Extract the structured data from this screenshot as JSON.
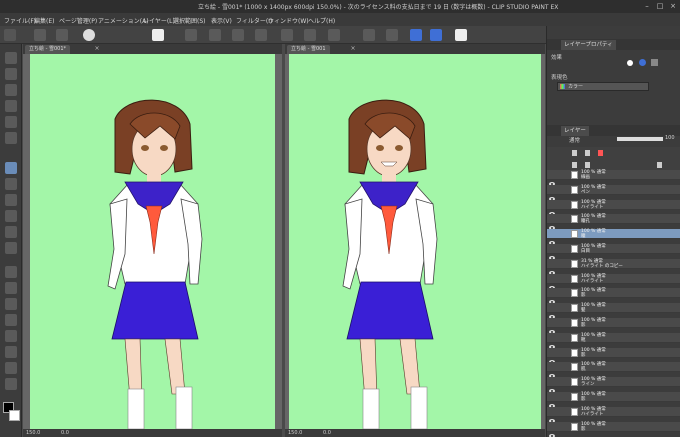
{
  "window": {
    "title": "立ち絵 - 雪001* (1000 x 1400px 600dpi 150.0%) - 次のライセンス料の支払日まで 19 日 (数字は概数) - CLIP STUDIO PAINT EX"
  },
  "menu": {
    "items": [
      "ファイル(F)",
      "編集(E)",
      "ページ管理(P)",
      "アニメーション(A)",
      "レイヤー(L)",
      "選択範囲(S)",
      "表示(V)",
      "フィルター(I)",
      "ウィンドウ(W)",
      "ヘルプ(H)"
    ]
  },
  "canvas_tabs": [
    {
      "label": "立ち絵 - 雪001*"
    },
    {
      "label": "立ち絵 - 雪001"
    }
  ],
  "status": {
    "zoom_left": "150.0",
    "rotation_left": "0.0",
    "zoom_right": "150.0",
    "rotation_right": "0.0"
  },
  "sub_tool_panel": {
    "tab_label": "レイヤープロパティ",
    "effect_label": "効果",
    "expression_color_label": "表現色",
    "expression_color_value": "カラー"
  },
  "layer_panel": {
    "tab_label": "レイヤー",
    "blend_mode": "通常",
    "opacity": "100",
    "layers": [
      {
        "line1": "100 % 通常",
        "line2": "線画",
        "selected": false,
        "eye": true
      },
      {
        "line1": "100 % 通常",
        "line2": "ペン",
        "selected": false,
        "eye": true
      },
      {
        "line1": "100 % 通常",
        "line2": "ハイライト",
        "selected": false,
        "eye": true
      },
      {
        "line1": "100 % 通常",
        "line2": "瞳孔",
        "selected": false,
        "eye": true
      },
      {
        "line1": "100 % 通常",
        "line2": "瞳",
        "selected": true,
        "eye": true
      },
      {
        "line1": "100 % 通常",
        "line2": "白目",
        "selected": false,
        "eye": true
      },
      {
        "line1": "31 % 通常",
        "line2": "ハイライト のコピー",
        "selected": false,
        "eye": true
      },
      {
        "line1": "100 % 通常",
        "line2": "ハイライト",
        "selected": false,
        "eye": true
      },
      {
        "line1": "100 % 通常",
        "line2": "影",
        "selected": false,
        "eye": true
      },
      {
        "line1": "100 % 通常",
        "line2": "髪",
        "selected": false,
        "eye": true
      },
      {
        "line1": "100 % 通常",
        "line2": "影",
        "selected": false,
        "eye": true
      },
      {
        "line1": "100 % 通常",
        "line2": "靴",
        "selected": false,
        "eye": true
      },
      {
        "line1": "100 % 通常",
        "line2": "影",
        "selected": false,
        "eye": true
      },
      {
        "line1": "100 % 通常",
        "line2": "肌",
        "selected": false,
        "eye": true
      },
      {
        "line1": "100 % 通常",
        "line2": "ライン",
        "selected": false,
        "eye": true
      },
      {
        "line1": "100 % 通常",
        "line2": "影",
        "selected": false,
        "eye": true
      },
      {
        "line1": "100 % 通常",
        "line2": "ハイライト",
        "selected": false,
        "eye": true
      },
      {
        "line1": "100 % 通常",
        "line2": "影",
        "selected": false,
        "eye": true
      }
    ]
  },
  "colors": {
    "canvas_bg": "#a3f6a8",
    "skirt": "#3a1fd6",
    "collar": "#3d22c9",
    "scarf": "#ff5a3c",
    "hair": "#7a4025",
    "selected_layer": "#7d9bbf"
  },
  "icons": {
    "visibility": "eye-icon",
    "lock": "lock-icon",
    "new_layer": "new-layer-icon",
    "delete": "trash-icon"
  }
}
